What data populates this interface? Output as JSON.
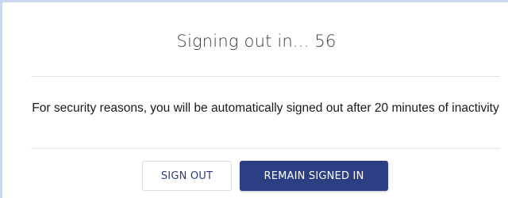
{
  "dialog": {
    "title": "Signing out in... 56",
    "message": "For security reasons, you will be automatically signed out after 20 minutes of inactivity",
    "sign_out_label": "SIGN OUT",
    "remain_label": "REMAIN SIGNED IN"
  },
  "colors": {
    "primary": "#2c3f82",
    "outline_text": "#2c3e7a",
    "frame_border": "#c9d8ee"
  }
}
